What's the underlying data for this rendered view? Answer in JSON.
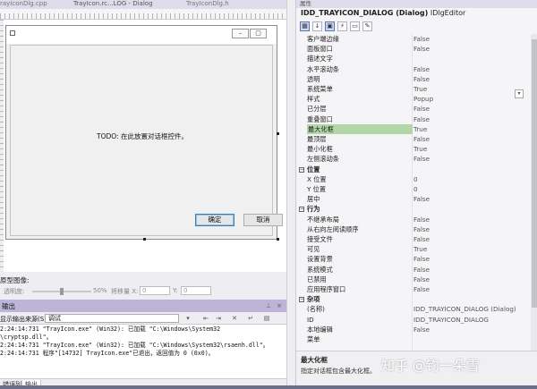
{
  "editor": {
    "tabs": [
      "rayIconDlg.cpp",
      "TrayIcon.rc...LOG - Dialog",
      "TrayIconDlg.h"
    ],
    "dialog": {
      "placeholder_text": "TODO: 在此放置对话框控件。",
      "ok_label": "确定",
      "cancel_label": "取消"
    },
    "prototype": {
      "title": "原型图像:",
      "transparency_label": "透明度:",
      "transparency_value": "50%",
      "transparency": 0.5,
      "offset_x_label": "将移量 X:",
      "offset_x": "0",
      "offset_y_label": "Y:",
      "offset_y": "0"
    }
  },
  "output": {
    "title": "输出",
    "source_label": "显示输出来源(S):",
    "source_value": "调试",
    "lines": [
      "2:24:14:731    \"TrayIcon.exe\" (Win32): 已加载 \"C:\\Windows\\System32",
      "\\cryptsp.dll\"。",
      "2:24:14:731    \"TrayIcon.exe\" (Win32): 已加载 \"C:\\Windows\\System32\\rsaenh.dll\"。",
      "2:24:14:731    程序\"[14732] TrayIcon.exe\"已退出，返回值为 0 (0x0)。"
    ],
    "tabs": [
      "错误列表",
      "输出"
    ]
  },
  "properties": {
    "caption": "属性",
    "object_name": "IDD_TRAYICON_DIALOG (Dialog)",
    "object_type": "IDlgEditor",
    "rows": [
      {
        "name": "客户端边缘",
        "value": "False"
      },
      {
        "name": "面板窗口",
        "value": "False"
      },
      {
        "name": "描述文字",
        "value": ""
      },
      {
        "name": "水平滚动条",
        "value": "False"
      },
      {
        "name": "透明",
        "value": "False"
      },
      {
        "name": "系统菜单",
        "value": "True"
      },
      {
        "name": "样式",
        "value": "Popup"
      },
      {
        "name": "已分层",
        "value": "False"
      },
      {
        "name": "重叠窗口",
        "value": "False"
      },
      {
        "name": "最大化框",
        "value": "True",
        "selected": true
      },
      {
        "name": "最顶层",
        "value": "False"
      },
      {
        "name": "最小化框",
        "value": "True"
      },
      {
        "name": "左侧滚动条",
        "value": "False"
      },
      {
        "name": "位置",
        "value": "",
        "category": true
      },
      {
        "name": "X 位置",
        "value": "0"
      },
      {
        "name": "Y 位置",
        "value": "0"
      },
      {
        "name": "居中",
        "value": "False"
      },
      {
        "name": "行为",
        "value": "",
        "category": true
      },
      {
        "name": "不继承布局",
        "value": "False"
      },
      {
        "name": "从右向左阅读顺序",
        "value": "False"
      },
      {
        "name": "接受文件",
        "value": "False"
      },
      {
        "name": "可见",
        "value": "True"
      },
      {
        "name": "设置背景",
        "value": "False"
      },
      {
        "name": "系统模式",
        "value": "False"
      },
      {
        "name": "已禁用",
        "value": "False"
      },
      {
        "name": "应用程序窗口",
        "value": "False"
      },
      {
        "name": "杂项",
        "value": "",
        "category": true
      },
      {
        "name": "(名称)",
        "value": "IDD_TRAYICON_DIALOG (Dialog)"
      },
      {
        "name": "ID",
        "value": "IDD_TRAYICON_DIALOG"
      },
      {
        "name": "本地编辑",
        "value": "False"
      },
      {
        "name": "菜单",
        "value": ""
      }
    ],
    "description_title": "最大化框",
    "description_text": "指定对话框包含最大化框。"
  },
  "watermark": "知乎 @钓一朵雪"
}
